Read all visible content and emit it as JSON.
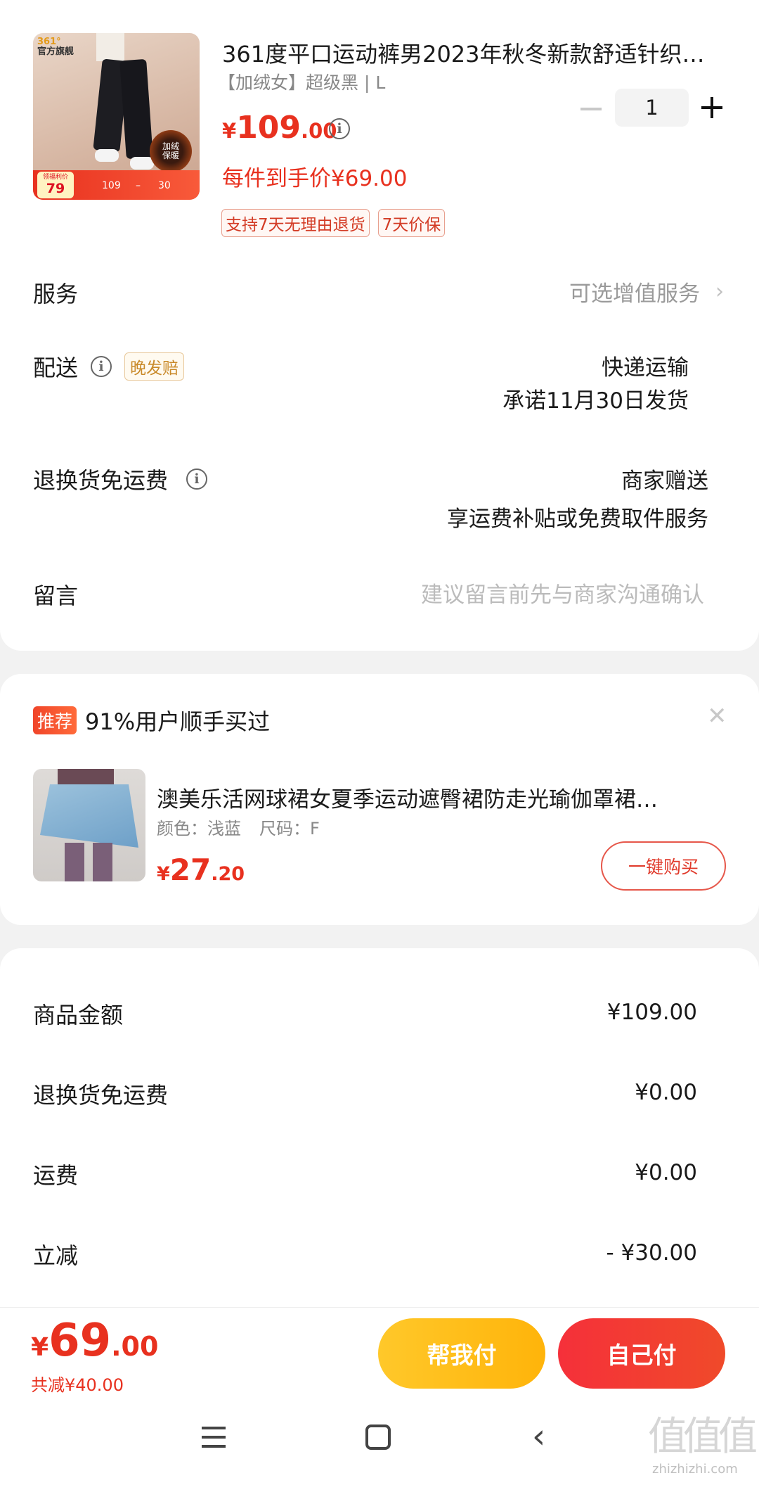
{
  "product": {
    "title": "361度平口运动裤男2023年秋冬新款舒适针织…",
    "variant": "【加绒女】超级黑 | L",
    "price_symbol": "¥",
    "price_main": "109",
    "price_decimal": ".00",
    "final_price_label": "每件到手价¥69.00",
    "quantity": "1",
    "tags": [
      "支持7天无理由退货",
      "7天价保"
    ],
    "thumb": {
      "brand_text": "官方旗舰",
      "badge_text": "加绒\n保暖",
      "bar_left_label": "领福利价",
      "bar_left_value": "79",
      "bar_mid_value": "109",
      "bar_right_value": "30"
    }
  },
  "rows": {
    "service_label": "服务",
    "service_value": "可选增值服务",
    "delivery_label": "配送",
    "delivery_badge": "晚发赔",
    "delivery_value1": "快递运输",
    "delivery_value2": "承诺11月30日发货",
    "return_label": "退换货免运费",
    "return_value1": "商家赠送",
    "return_value2": "享运费补贴或免费取件服务",
    "note_label": "留言",
    "note_placeholder": "建议留言前先与商家沟通确认"
  },
  "recommend": {
    "badge": "推荐",
    "title": "91%用户顺手买过",
    "item_title": "澳美乐活网球裙女夏季运动遮臀裙防走光瑜伽罩裙…",
    "item_color": "颜色：浅蓝",
    "item_size": "尺码：F",
    "price_symbol": "¥",
    "price_main": "27",
    "price_decimal": ".20",
    "buy_button": "一键购买"
  },
  "summary": [
    {
      "label": "商品金额",
      "value": "¥109.00",
      "red": false
    },
    {
      "label": "退换货免运费",
      "value": "¥0.00",
      "red": false
    },
    {
      "label": "运费",
      "value": "¥0.00",
      "red": false
    },
    {
      "label": "立减",
      "value": "- ¥30.00",
      "red": true
    }
  ],
  "footer": {
    "price_symbol": "¥",
    "price_main": "69",
    "price_decimal": ".00",
    "discount": "共减¥40.00",
    "help_pay": "帮我付",
    "self_pay": "自己付"
  },
  "watermark": {
    "chars": "值值值",
    "url": "zhizhizhi.com"
  },
  "colors": {
    "accent_red": "#e8311f",
    "help_pay_yellow": "#ffc11a",
    "self_pay_red": "#f0293a"
  }
}
